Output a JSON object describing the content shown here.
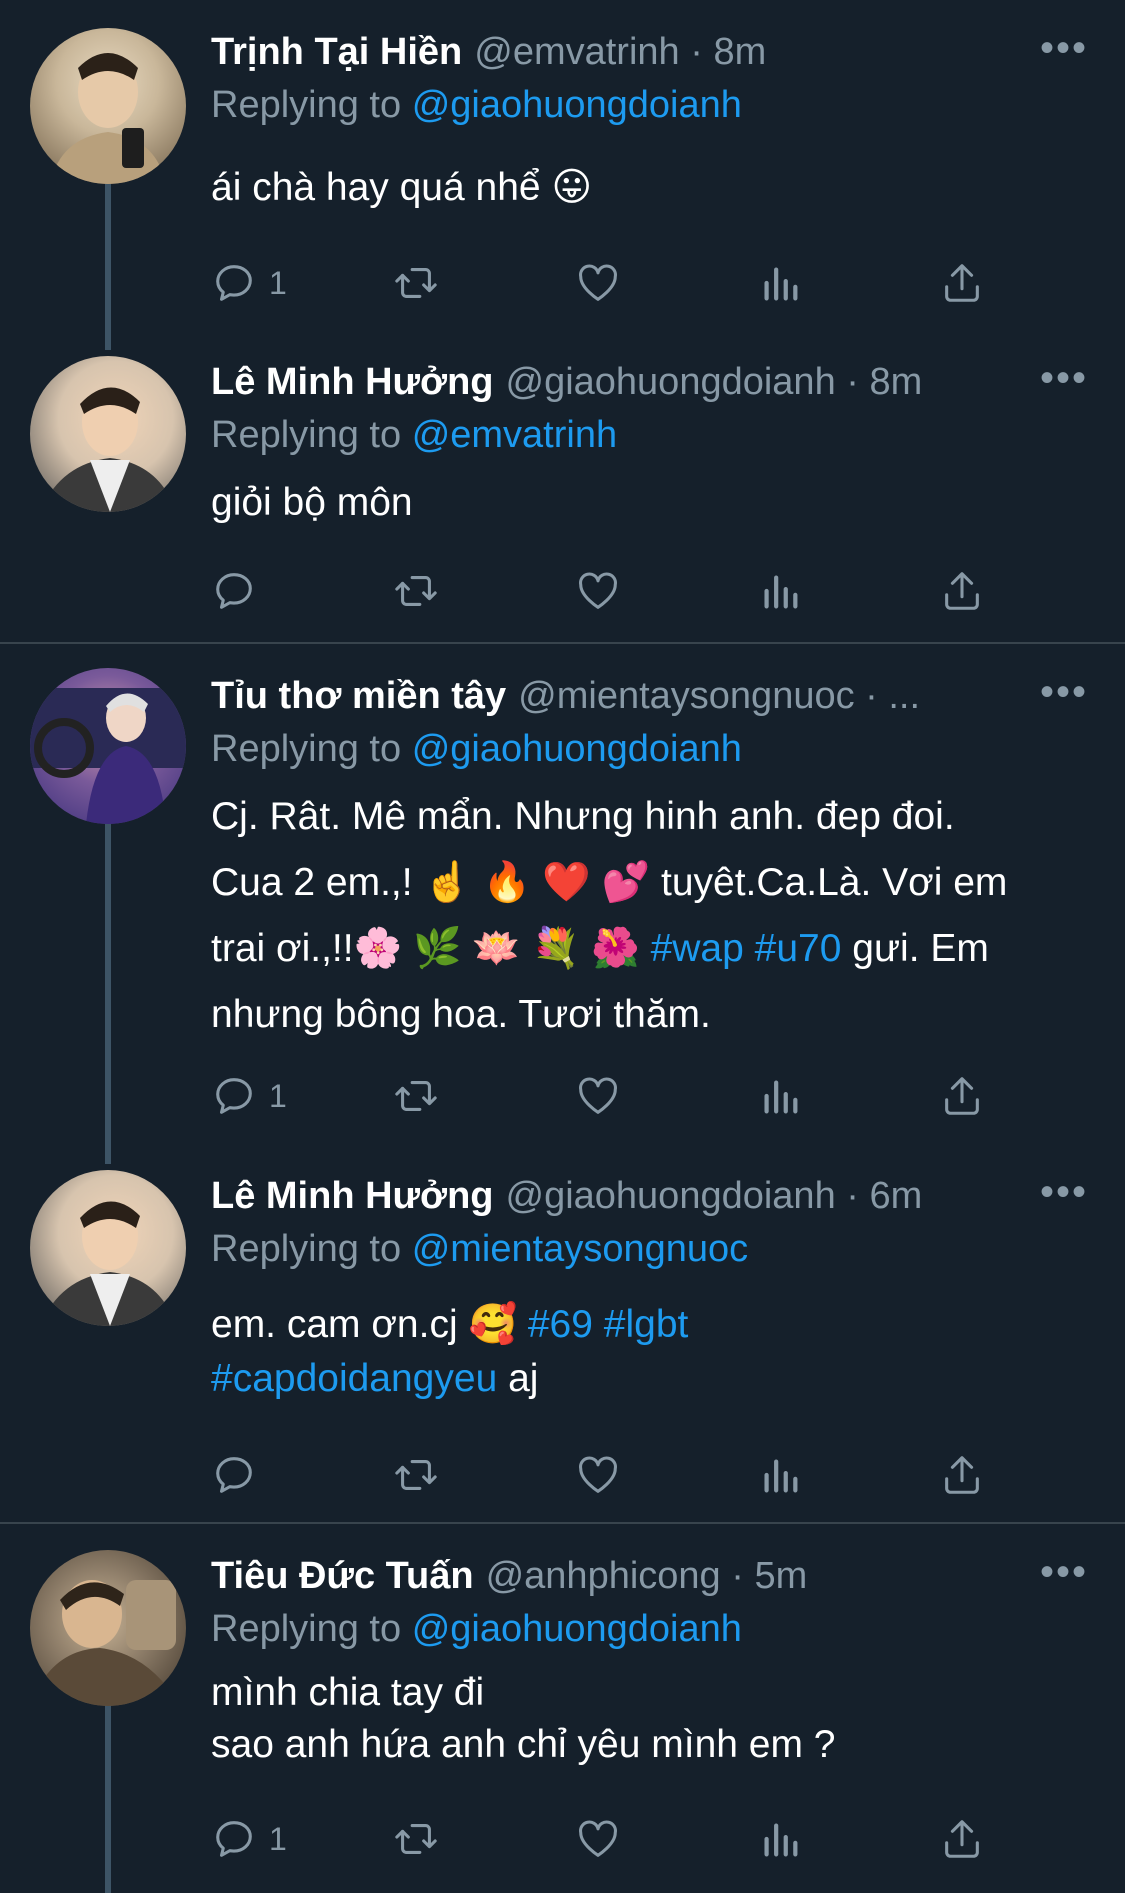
{
  "tweets": [
    {
      "name": "Trịnh Tại Hiền",
      "handle": "@emvatrinh · 8m",
      "replying_prefix": "Replying to",
      "replying_to": "@giaohuongdoianh",
      "text": "ái chà hay quá nhể 😛",
      "reply_count": "1",
      "avatar_colors": [
        "#c9b79a",
        "#6b5a43"
      ]
    },
    {
      "name": "Lê Minh Hưởng",
      "handle": "@giaohuongdoianh · 8m",
      "replying_prefix": "Replying to",
      "replying_to": "@emvatrinh",
      "text": "giỏi bộ môn",
      "reply_count": "",
      "avatar_colors": [
        "#d7c4ae",
        "#4a4a4a"
      ]
    },
    {
      "name": "Tỉu thơ miền tây",
      "handle": "@mientaysongnuoc · ...",
      "replying_prefix": "Replying to",
      "replying_to": "@giaohuongdoianh",
      "text_line1": "Cj. Rât. Mê mẩn. Nhưng hinh anh. đep đoi.",
      "text_line2": "Cua 2 em.,! ☝️ 🔥 ❤️ 💕  tuyêt.Ca.Là. Vơi em",
      "text_line3a": "trai ơi.,!!🌸 🌿 🪷 💐 🌺 ",
      "tag_wap": "#wap",
      "tag_u70": "#u70",
      "text_line3b": " gưi. Em",
      "text_line4": "nhưng bông hoa. Tươi thăm.",
      "reply_count": "1",
      "avatar_colors": [
        "#3a2f7a",
        "#d9a0b0"
      ]
    },
    {
      "name": "Lê Minh Hưởng",
      "handle": "@giaohuongdoianh · 6m",
      "replying_prefix": "Replying to",
      "replying_to": "@mientaysongnuoc",
      "text_line1a": "em. cam ơn.cj 🥰 ",
      "tag_69": "#69",
      "tag_lgbt": "#lgbt",
      "tag_capdoi": "#capdoidangyeu",
      "text_line2b": " aj",
      "reply_count": "",
      "avatar_colors": [
        "#d7c4ae",
        "#4a4a4a"
      ]
    },
    {
      "name": "Tiêu Đức Tuấn",
      "handle": "@anhphicong · 5m",
      "replying_prefix": "Replying to",
      "replying_to": "@giaohuongdoianh",
      "text_line1": "mình chia tay đi",
      "text_line2": "sao anh hứa anh chỉ yêu mình em ?",
      "reply_count": "1",
      "avatar_colors": [
        "#8a7a66",
        "#3d3328"
      ]
    }
  ],
  "more_glyph": "•••",
  "colors": {
    "background": "#15202b",
    "secondary_text": "#8899a6",
    "link": "#1d9bf0",
    "thread_line": "#3d5466",
    "divider": "#38444d"
  }
}
